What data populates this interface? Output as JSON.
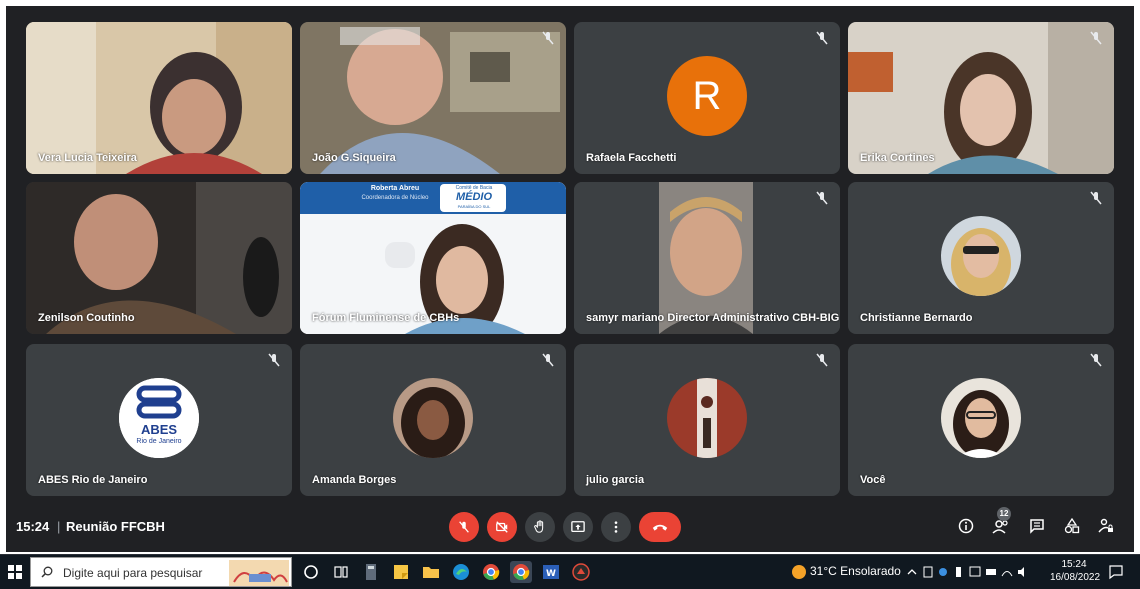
{
  "participants": [
    {
      "name": "Vera Lucia Teixeira"
    },
    {
      "name": "João G.Siqueira"
    },
    {
      "name": "Rafaela Facchetti",
      "initial": "R"
    },
    {
      "name": "Erika Cortines"
    },
    {
      "name": "Zenilson Coutinho"
    },
    {
      "name": "Fórum Fluminense de CBHs",
      "slide_name": "Roberta Abreu",
      "slide_role": "Coordenadora de Núcleo",
      "slide_logo": "MÉDIO",
      "slide_logo_sub": "PARAÍBA DO SUL",
      "slide_logo_top": "Comitê de Bacia"
    },
    {
      "name": "samyr mariano Director Administrativo CBH-BIG"
    },
    {
      "name": "Christianne Bernardo"
    },
    {
      "name": "ABES Rio de Janeiro",
      "logo_text": "ABES",
      "logo_sub": "Rio de Janeiro"
    },
    {
      "name": "Amanda Borges"
    },
    {
      "name": "julio garcia"
    },
    {
      "name": "Você"
    }
  ],
  "bottom_bar": {
    "time": "15:24",
    "separator": "|",
    "meeting_name": "Reunião FFCBH",
    "participant_count": "12"
  },
  "taskbar": {
    "search_placeholder": "Digite aqui para pesquisar",
    "weather": "31°C  Ensolarado",
    "clock_time": "15:24",
    "clock_date": "16/08/2022"
  },
  "colors": {
    "meet_bg": "#202124",
    "tile_bg": "#3c4043",
    "danger": "#ea4335",
    "avatar_orange": "#e8710a"
  }
}
